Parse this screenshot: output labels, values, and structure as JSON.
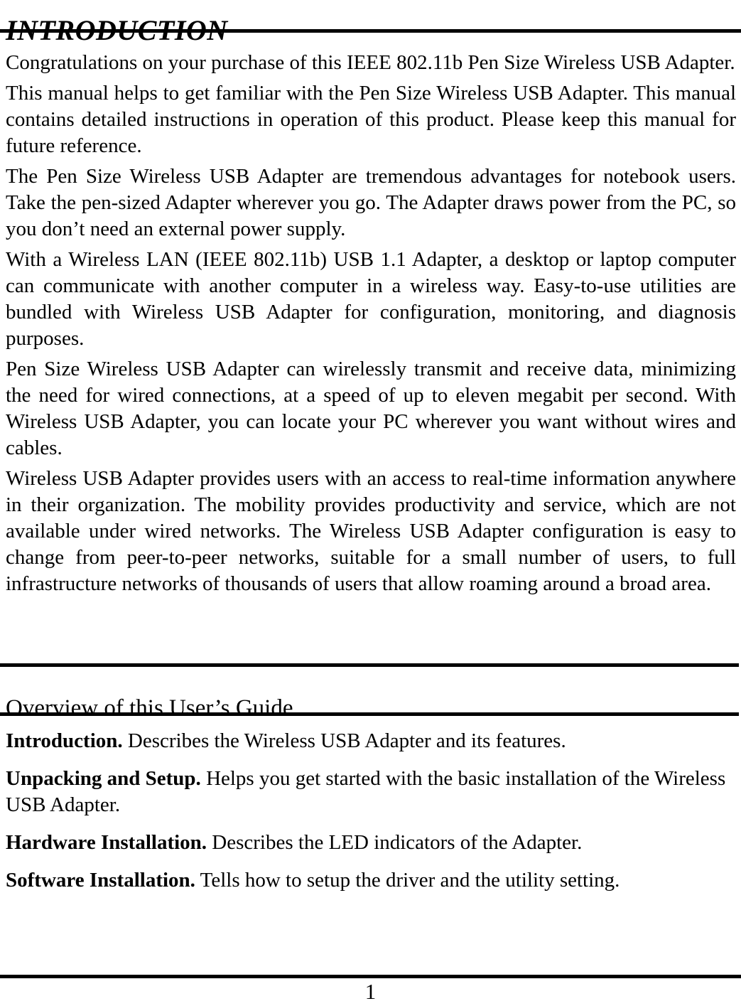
{
  "document": {
    "chapter_title": "INTRODUCTION",
    "paragraphs": [
      "Congratulations on your purchase of this IEEE 802.11b Pen Size Wireless USB Adapter.",
      "This manual helps to get familiar with the Pen Size Wireless USB Adapter. This manual contains detailed instructions in operation of this product. Please keep this manual for future reference.",
      "The Pen Size Wireless USB Adapter are tremendous advantages for notebook users. Take the pen-sized Adapter wherever you go. The Adapter draws power from the PC, so you don’t need an external power supply.",
      "With a Wireless LAN (IEEE 802.11b) USB 1.1 Adapter, a desktop or laptop computer can communicate with another computer in a wireless way. Easy-to-use utilities are bundled with Wireless USB Adapter for configuration, monitoring, and diagnosis purposes.",
      "Pen Size Wireless USB Adapter can wirelessly transmit and receive data, minimizing the need for wired connections, at a speed of up to eleven megabit per second. With Wireless USB Adapter, you can locate your PC wherever you want without wires and cables.",
      "Wireless USB Adapter provides users with an access to real-time information anywhere in their organization. The mobility provides productivity and service, which are not available under wired networks. The Wireless USB Adapter configuration is easy to change from peer-to-peer networks, suitable for a small number of users, to full infrastructure networks of thousands of users that allow roaming around a broad area."
    ],
    "section": {
      "heading": "Overview of this User’s Guide",
      "items": [
        {
          "lead": "Introduction.",
          "text": "  Describes the Wireless USB Adapter and its features."
        },
        {
          "lead": "Unpacking and Setup.",
          "text": "  Helps you get started with the basic installation of the Wireless USB Adapter."
        },
        {
          "lead": "Hardware Installation.",
          "text": "  Describes the LED indicators of the Adapter."
        },
        {
          "lead": "Software Installation.",
          "text": "  Tells how to setup the driver and the utility setting."
        }
      ]
    },
    "footer": {
      "page_number": "1"
    }
  }
}
